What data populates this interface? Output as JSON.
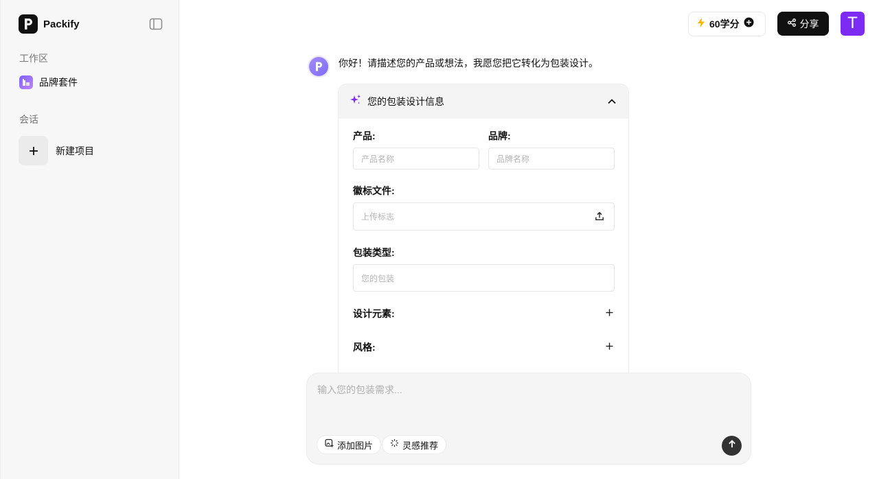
{
  "brand": {
    "name": "Packify"
  },
  "sidebar": {
    "workspace_label": "工作区",
    "workspace_items": [
      {
        "label": "品牌套件",
        "icon": "brand-kit-icon"
      }
    ],
    "sessions_label": "会话",
    "new_project_label": "新建项目"
  },
  "topbar": {
    "credits": "60学分",
    "share_label": "分享",
    "avatar_initial": "T"
  },
  "chat": {
    "greeting": "你好！请描述您的产品或想法，我愿您把它转化为包装设计。",
    "card": {
      "title": "您的包装设计信息",
      "product_label": "产品:",
      "product_placeholder": "产品名称",
      "brand_label": "品牌:",
      "brand_placeholder": "品牌名称",
      "logo_label": "徽标文件:",
      "logo_placeholder": "上传标志",
      "packaging_label": "包装类型:",
      "packaging_placeholder": "您的包装",
      "design_elements_label": "设计元素:",
      "style_label": "风格:"
    }
  },
  "composer": {
    "placeholder": "输入您的包装需求...",
    "add_image_label": "添加图片",
    "inspiration_label": "灵感推荐"
  },
  "colors": {
    "accent": "#7c2cf2",
    "credits_bolt": "#f5b400",
    "dark_button": "#111111"
  }
}
